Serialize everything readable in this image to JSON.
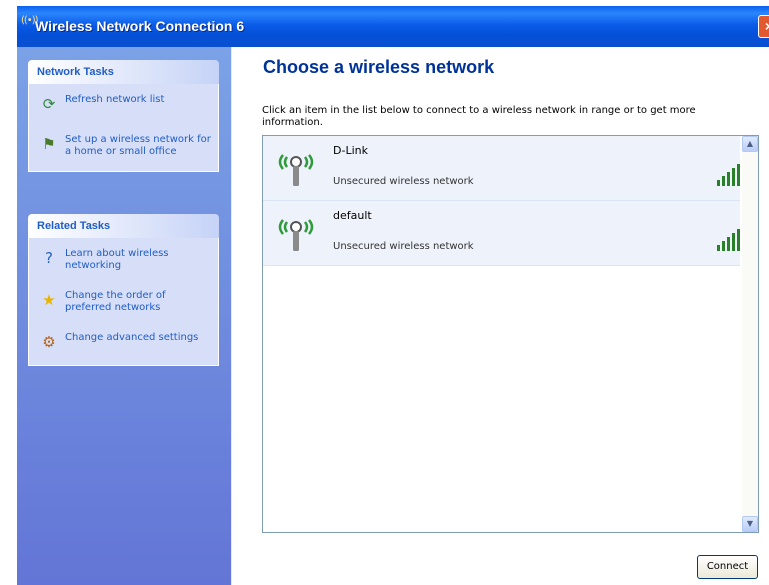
{
  "window": {
    "title": "Wireless Network Connection 6",
    "close_label": "×"
  },
  "sidebar": {
    "network_tasks": {
      "heading": "Network Tasks",
      "items": [
        {
          "label": "Refresh network list",
          "icon": "refresh-icon"
        },
        {
          "label": "Set up a wireless network for a home or small office",
          "icon": "setup-network-icon"
        }
      ]
    },
    "related_tasks": {
      "heading": "Related Tasks",
      "items": [
        {
          "label": "Learn about wireless networking",
          "icon": "help-icon"
        },
        {
          "label": "Change the order of preferred networks",
          "icon": "star-icon"
        },
        {
          "label": "Change advanced settings",
          "icon": "settings-icon"
        }
      ]
    }
  },
  "main": {
    "title": "Choose a wireless network",
    "instructions": "Click an item in the list below to connect to a wireless network in range or to get more information.",
    "networks": [
      {
        "name": "D-Link",
        "status": "Unsecured wireless network",
        "signal_bars": 5,
        "selected": true
      },
      {
        "name": "default",
        "status": "Unsecured wireless network",
        "signal_bars": 5,
        "selected": false
      }
    ],
    "connect_label": "Connect"
  },
  "colors": {
    "titlebar": "#0a4fd0",
    "sidebar": "#6f8fdf",
    "task_heading": "#215dc6",
    "main_title": "#003399",
    "selected_row": "#eef2fb"
  }
}
